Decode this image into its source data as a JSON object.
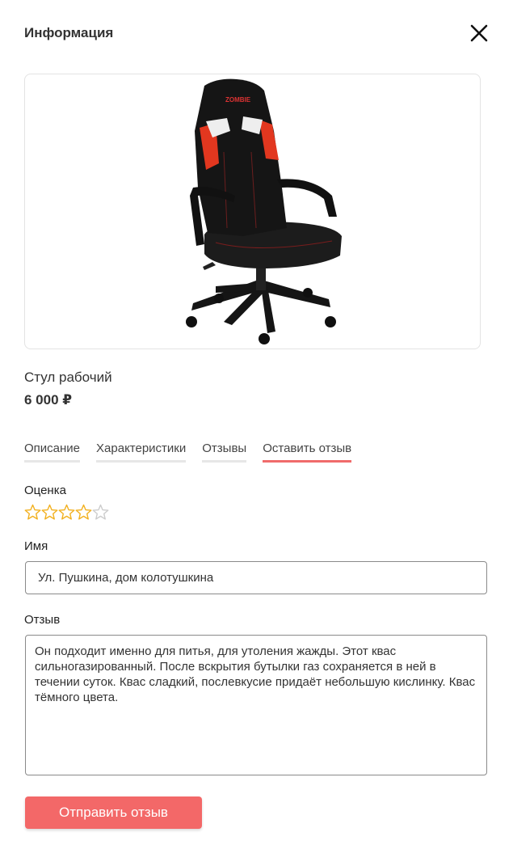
{
  "header": {
    "title": "Информация",
    "close_icon": "close-icon"
  },
  "product": {
    "image": "gaming-chair-image",
    "name": "Стул рабочий",
    "price": "6 000 ₽"
  },
  "tabs": [
    {
      "label": "Описание",
      "active": false
    },
    {
      "label": "Характеристики",
      "active": false
    },
    {
      "label": "Отзывы",
      "active": false
    },
    {
      "label": "Оставить отзыв",
      "active": true
    }
  ],
  "form": {
    "rating_label": "Оценка",
    "rating": {
      "value": 4,
      "max": 5,
      "filled_color": "#f2b01e",
      "empty_color": "#cccccc"
    },
    "name_label": "Имя",
    "name_value": "Ул. Пушкина, дом колотушкина",
    "review_label": "Отзыв",
    "review_value": "Он подходит именно для питья, для утоления жажды. Этот квас сильногазированный. После вскрытия бутылки газ сохраняется в ней в течении суток. Квас сладкий, послевкусие придаёт небольшую кислинку. Квас тёмного цвета.",
    "submit_label": "Отправить отзыв"
  },
  "colors": {
    "accent": "#f36868",
    "tab_underline": "#e7e7e7",
    "tab_active_underline": "#f06b6b"
  }
}
